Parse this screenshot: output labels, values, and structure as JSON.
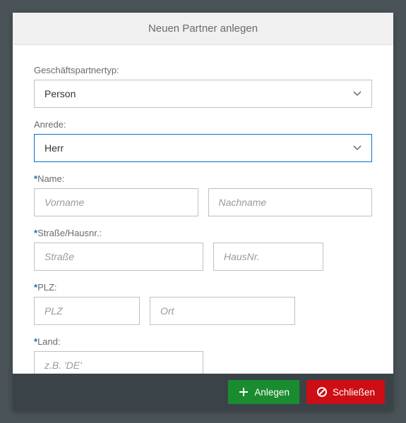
{
  "dialog": {
    "title": "Neuen Partner anlegen"
  },
  "fields": {
    "partnerType": {
      "label": "Geschäftspartnertyp:",
      "value": "Person"
    },
    "salutation": {
      "label": "Anrede:",
      "value": "Herr"
    },
    "name": {
      "label": "Name:",
      "firstName": {
        "placeholder": "Vorname"
      },
      "lastName": {
        "placeholder": "Nachname"
      }
    },
    "street": {
      "label": "Straße/Hausnr.:",
      "street": {
        "placeholder": "Straße"
      },
      "houseNo": {
        "placeholder": "HausNr."
      }
    },
    "postal": {
      "label": "PLZ:",
      "plz": {
        "placeholder": "PLZ"
      },
      "city": {
        "placeholder": "Ort"
      }
    },
    "country": {
      "label": "Land:",
      "placeholder": "z.B. 'DE'"
    }
  },
  "buttons": {
    "create": "Anlegen",
    "close": "Schließen"
  },
  "required": "*"
}
